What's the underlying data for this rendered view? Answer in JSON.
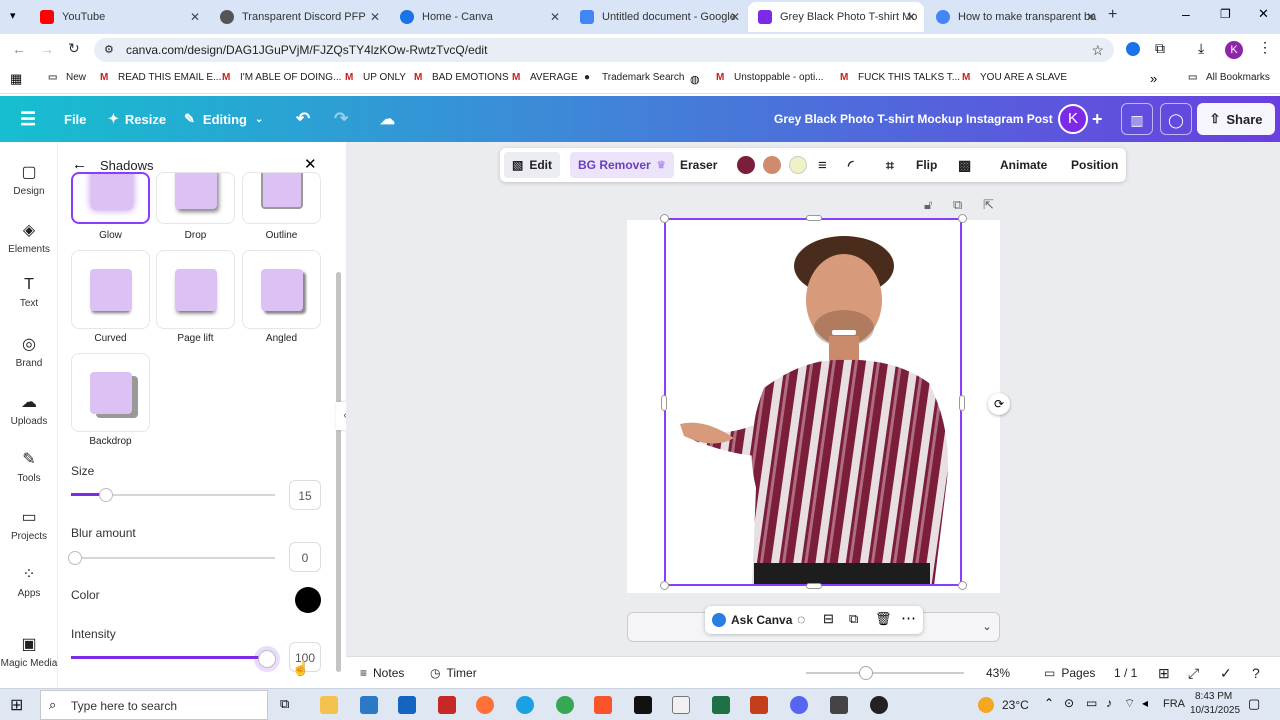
{
  "browser": {
    "tabs": [
      {
        "title": "YouTube",
        "color": "#ff0000"
      },
      {
        "title": "Transparent Discord PFP",
        "color": "#555555"
      },
      {
        "title": "Home - Canva",
        "color": "#1a73e8"
      },
      {
        "title": "Untitled document - Google",
        "color": "#4285f4"
      },
      {
        "title": "Grey Black Photo T-shirt Mo",
        "color": "#7d2ae8"
      },
      {
        "title": "How to make transparent ba",
        "color": "#4285f4"
      }
    ],
    "url": "canva.com/design/DAG1JGuPVjM/FJZQsTY4lzKOw-RwtzTvcQ/edit",
    "bookmarks": [
      "New",
      "READ THIS EMAIL E...",
      "I'M ABLE OF DOING...",
      "UP ONLY",
      "BAD EMOTIONS",
      "AVERAGE",
      "Trademark Search",
      "Unstoppable - opti...",
      "FUCK THIS TALKS T...",
      "YOU ARE A SLAVE"
    ],
    "all_bookmarks": "All Bookmarks",
    "avatar": "K"
  },
  "canva_header": {
    "file": "File",
    "resize": "Resize",
    "editing": "Editing",
    "title": "Grey Black Photo T-shirt Mockup Instagram Post",
    "avatar": "K",
    "share": "Share"
  },
  "rail": [
    "Design",
    "Elements",
    "Text",
    "Brand",
    "Uploads",
    "Tools",
    "Projects",
    "Apps",
    "Magic Media"
  ],
  "panel": {
    "title": "Shadows",
    "cards": [
      "Glow",
      "Drop",
      "Outline",
      "Curved",
      "Page lift",
      "Angled",
      "Backdrop"
    ],
    "size_label": "Size",
    "size_value": "15",
    "size_level": 0.15,
    "blur_label": "Blur amount",
    "blur_value": "0",
    "blur_level": 0,
    "color_label": "Color",
    "color_value": "#000000",
    "intensity_label": "Intensity",
    "intensity_value": "100",
    "intensity_level": 1.0
  },
  "context_toolbar": {
    "edit": "Edit",
    "bg_remover": "BG Remover",
    "eraser": "Eraser",
    "swatches": [
      "#7a1e3a",
      "#d08a6e",
      "#eef2c4"
    ],
    "flip": "Flip",
    "animate": "Animate",
    "position": "Position"
  },
  "float_toolbar": {
    "ask": "Ask Canva"
  },
  "bottom": {
    "notes": "Notes",
    "timer": "Timer",
    "zoom": "43%",
    "zoom_level": 0.43,
    "pages": "Pages",
    "page_count": "1 / 1"
  },
  "taskbar": {
    "search": "Type here to search",
    "temp": "23°C",
    "lang": "FRA",
    "time": "8:43 PM",
    "date": "10/31/2025"
  }
}
